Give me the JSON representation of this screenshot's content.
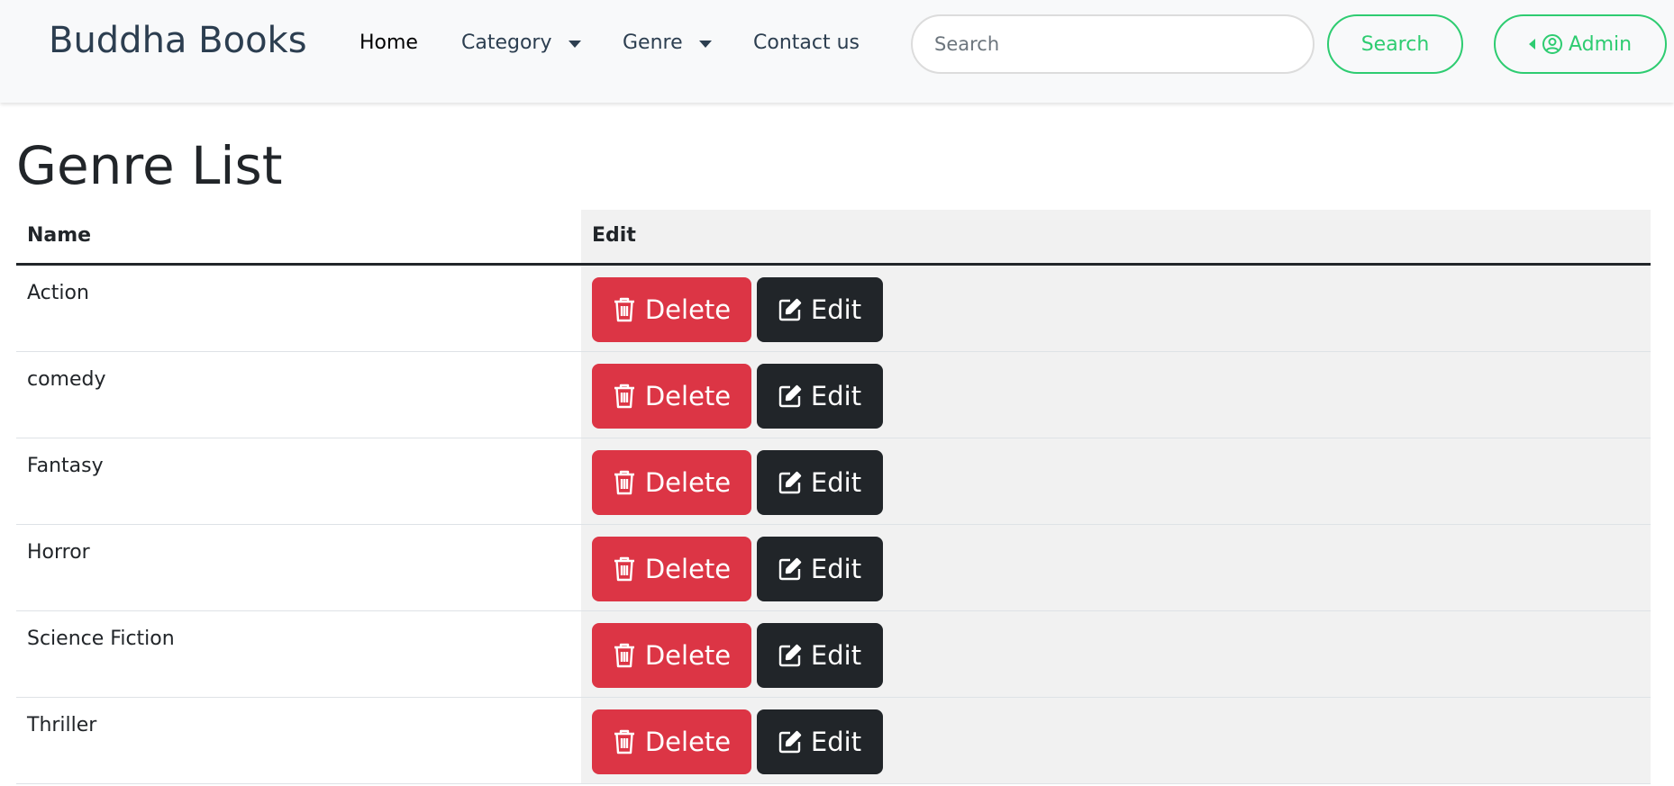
{
  "navbar": {
    "brand": "Buddha Books",
    "links": [
      {
        "label": "Home",
        "active": true
      },
      {
        "label": "Category",
        "dropdown": true
      },
      {
        "label": "Genre",
        "dropdown": true
      },
      {
        "label": "Contact us"
      }
    ],
    "search": {
      "placeholder": "Search",
      "value": "",
      "button_label": "Search"
    },
    "admin_label": "Admin"
  },
  "page": {
    "title": "Genre List"
  },
  "table": {
    "headers": {
      "name": "Name",
      "edit": "Edit"
    },
    "rows": [
      {
        "name": "Action"
      },
      {
        "name": "comedy"
      },
      {
        "name": "Fantasy"
      },
      {
        "name": "Horror"
      },
      {
        "name": "Science Fiction"
      },
      {
        "name": "Thriller"
      }
    ],
    "delete_label": "Delete",
    "edit_label": "Edit"
  },
  "colors": {
    "accent": "#2ecc71",
    "danger": "#dc3545",
    "dark": "#212529",
    "brand_text": "#2c3e50"
  }
}
